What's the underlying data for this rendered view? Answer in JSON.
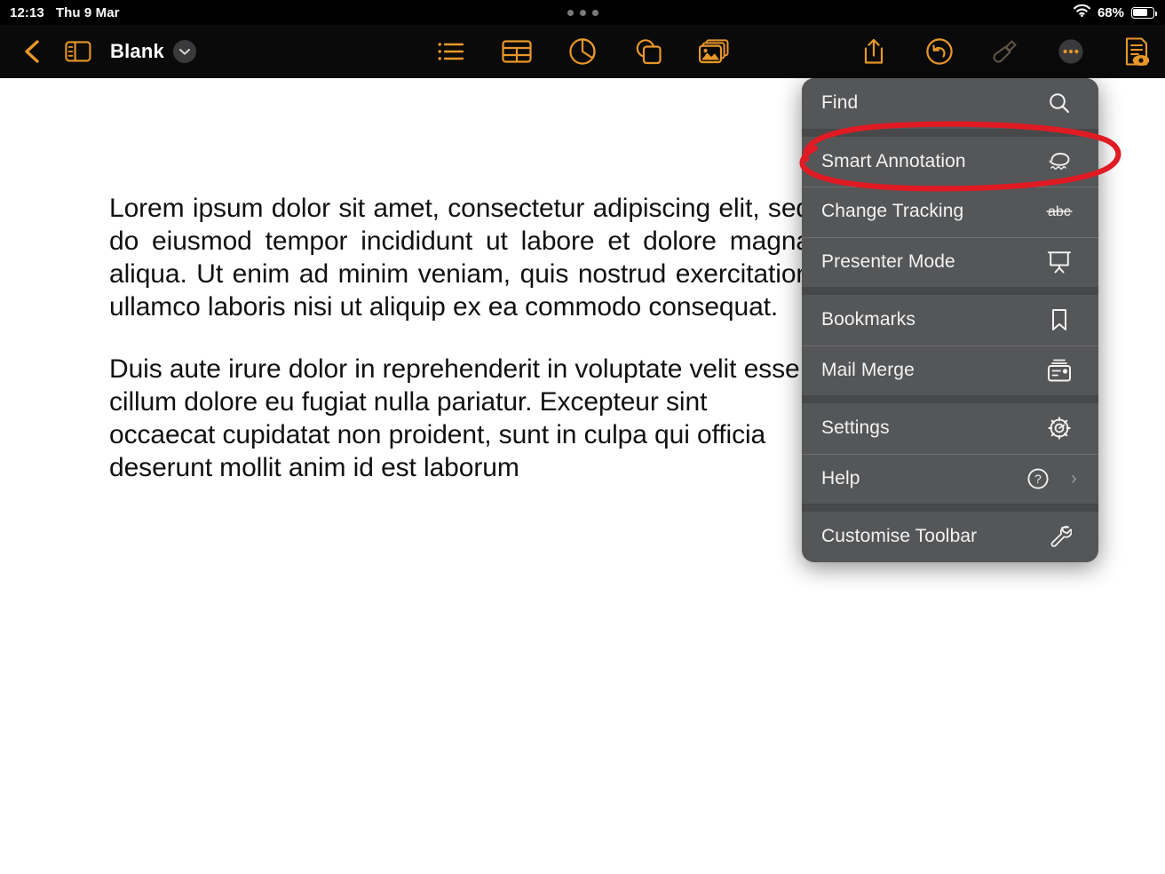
{
  "status_bar": {
    "time": "12:13",
    "date": "Thu 9 Mar",
    "battery_percent": "68%",
    "wifi_icon": "wifi-icon",
    "battery_icon": "battery-icon",
    "multitask_handle": "multitask-dots"
  },
  "toolbar": {
    "back_icon": "back-chevron-icon",
    "sidebar_icon": "sidebar-toggle-icon",
    "document_title": "Blank",
    "title_chevron_icon": "chevron-down-icon",
    "center_tools": [
      {
        "name": "list-icon",
        "label": "List"
      },
      {
        "name": "table-icon",
        "label": "Table"
      },
      {
        "name": "chart-icon",
        "label": "Chart"
      },
      {
        "name": "shape-icon",
        "label": "Shape"
      },
      {
        "name": "media-icon",
        "label": "Media"
      }
    ],
    "right_tools": [
      {
        "name": "share-icon",
        "label": "Share",
        "state": "enabled"
      },
      {
        "name": "undo-icon",
        "label": "Undo",
        "state": "enabled"
      },
      {
        "name": "format-brush-icon",
        "label": "Format",
        "state": "dimmed"
      },
      {
        "name": "more-ellipsis-icon",
        "label": "More",
        "state": "enabled"
      },
      {
        "name": "document-view-icon",
        "label": "Document Options",
        "state": "active"
      }
    ],
    "accent_color": "#e8972a",
    "background_color": "#0a0a0a"
  },
  "document": {
    "paragraphs": [
      "Lorem ipsum dolor sit amet, consectetur adipiscing elit, sed do eiusmod tempor incididunt ut labore et dolore magna aliqua. Ut enim ad minim veniam, quis nostrud exercitation ullamco laboris nisi ut aliquip ex ea commodo consequat.",
      "Duis aute irure dolor in reprehenderit in voluptate velit esse cillum dolore eu fugiat nulla pariatur. Excepteur sint occaecat cupidatat non proident, sunt in culpa qui officia deserunt mollit anim id est laborum"
    ],
    "page_background": "#ffffff",
    "text_color": "#111111"
  },
  "menu": {
    "background_color": "#555658",
    "separator_color": "#474849",
    "groups": [
      {
        "items": [
          {
            "label": "Find",
            "icon": "search-icon",
            "has_submenu": false
          }
        ]
      },
      {
        "items": [
          {
            "label": "Smart Annotation",
            "icon": "smart-annotation-icon",
            "has_submenu": false
          },
          {
            "label": "Change Tracking",
            "icon": "change-tracking-abc-icon",
            "has_submenu": false
          },
          {
            "label": "Presenter Mode",
            "icon": "presenter-mode-icon",
            "has_submenu": false
          }
        ]
      },
      {
        "items": [
          {
            "label": "Bookmarks",
            "icon": "bookmark-icon",
            "has_submenu": false
          },
          {
            "label": "Mail Merge",
            "icon": "mail-merge-icon",
            "has_submenu": false
          }
        ]
      },
      {
        "items": [
          {
            "label": "Settings",
            "icon": "gear-icon",
            "has_submenu": false
          },
          {
            "label": "Help",
            "icon": "help-circle-icon",
            "has_submenu": true,
            "chevron": "›"
          }
        ]
      },
      {
        "items": [
          {
            "label": "Customise Toolbar",
            "icon": "wrench-icon",
            "has_submenu": false
          }
        ]
      }
    ]
  },
  "annotation": {
    "type": "hand-drawn-ellipse",
    "color": "#e01b24",
    "target_label": "Smart Annotation",
    "stroke_width": 6
  }
}
